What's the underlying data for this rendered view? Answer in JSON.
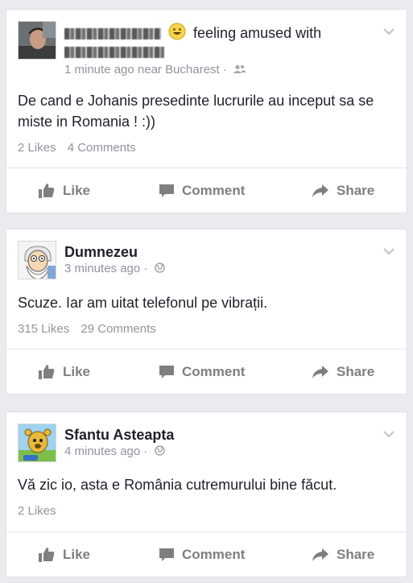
{
  "posts": [
    {
      "feeling_text": "feeling amused with",
      "time": "1 minute ago near Bucharest",
      "text": "De cand e Johanis presedinte lucrurile au inceput sa se miste in Romania ! :))",
      "likes": "2 Likes",
      "comments": "4 Comments",
      "privacy_icon": "friends-icon"
    },
    {
      "author": "Dumnezeu",
      "time": "3 minutes ago",
      "text": "Scuze. Iar am uitat telefonul pe vibrații.",
      "likes": "315 Likes",
      "comments": "29 Comments",
      "privacy_icon": "globe-icon"
    },
    {
      "author": "Sfantu Asteapta",
      "time": "4 minutes ago",
      "text": "Vă zic io, asta e România cutremurului bine făcut.",
      "likes": "2 Likes",
      "privacy_icon": "globe-icon"
    }
  ],
  "actions": {
    "like": "Like",
    "comment": "Comment",
    "share": "Share"
  },
  "colors": {
    "background": "#e9ebee",
    "text": "#1d2129",
    "meta": "#90949c",
    "action": "#7f7f7f"
  }
}
